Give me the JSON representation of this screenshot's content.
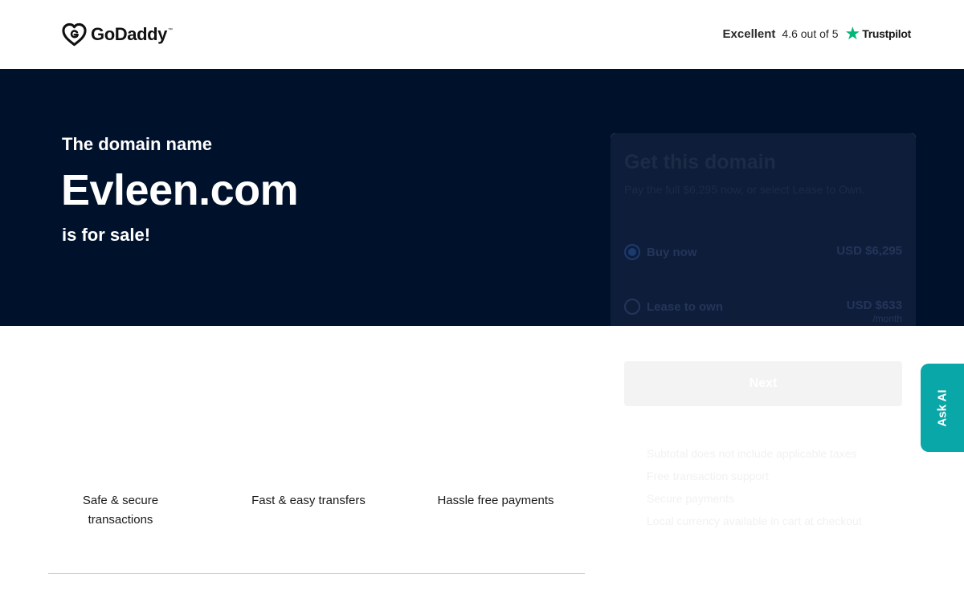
{
  "header": {
    "logo_text": "GoDaddy",
    "rating_label": "Excellent",
    "rating_score": "4.6 out of 5",
    "trustpilot_label": "Trustpilot",
    "trustpilot_star_color": "#00b67a"
  },
  "hero": {
    "pre": "The domain name",
    "domain": "Evleen.com",
    "post": "is for sale!",
    "background_color": "#00112c"
  },
  "purchase": {
    "title": "Get this domain",
    "subtitle": "Pay the full $6,295 now, or select Lease to Own.",
    "options": [
      {
        "label": "Buy now",
        "price": "USD $6,295",
        "per": "",
        "selected": true
      },
      {
        "label": "Lease to own",
        "price": "USD $633",
        "per": "/month",
        "selected": false
      }
    ],
    "next_label": "Next",
    "notes": [
      "Subtotal does not include applicable taxes",
      "Free transaction support",
      "Secure payments",
      "Local currency available in cart at checkout"
    ]
  },
  "ask_ai": {
    "label": "Ask AI",
    "color": "#09a7a7"
  },
  "features": [
    {
      "line1": "Safe & secure",
      "line2": "transactions"
    },
    {
      "line1": "Fast & easy transfers",
      "line2": ""
    },
    {
      "line1": "Hassle free payments",
      "line2": ""
    }
  ]
}
